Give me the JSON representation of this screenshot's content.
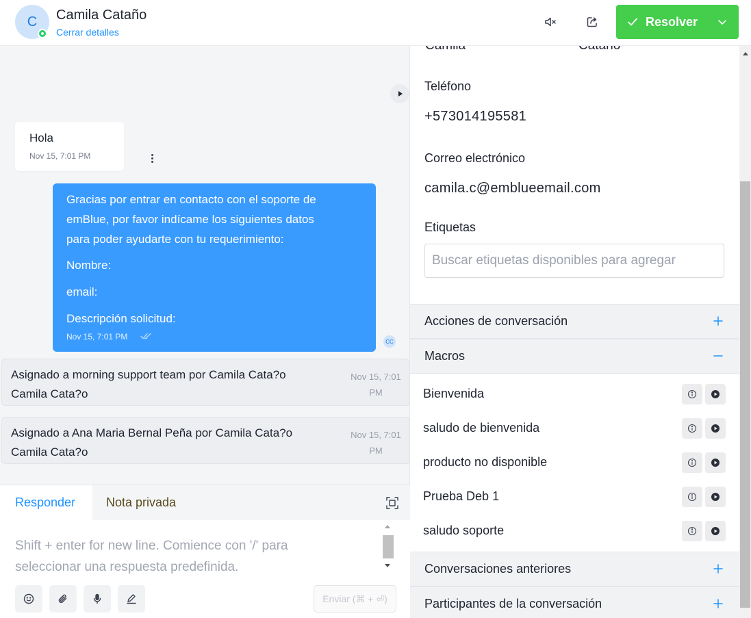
{
  "header": {
    "avatar_initial": "C",
    "contact_name": "Camila Cataño",
    "close_details": "Cerrar detalles",
    "mute_icon": "volume-mute-icon",
    "share_icon": "share-icon",
    "resolve_label": "Resolver",
    "accent": "#44ce4b",
    "channel_icon": "whatsapp-icon"
  },
  "chat": {
    "incoming": {
      "text": "Hola",
      "time": "Nov 15, 7:01 PM"
    },
    "outgoing": {
      "lines": [
        "Gracias por entrar en contacto con el soporte de",
        "emBlue, por favor indícame los siguientes datos",
        "para poder ayudarte con tu requerimiento:",
        "Nombre:",
        "email:",
        "Descripción solicitud:"
      ],
      "time": "Nov 15, 7:01 PM",
      "agent_initials": "CC",
      "bubble_color": "#3a9bff"
    },
    "activities": [
      {
        "line1": "Asignado a morning support team por Camila Cata?o",
        "line2": "Camila Cata?o",
        "time1": "Nov 15, 7:01",
        "time2": "PM"
      },
      {
        "line1": "Asignado a Ana Maria Bernal Peña por Camila Cata?o",
        "line2": "Camila Cata?o",
        "time1": "Nov 15, 7:01",
        "time2": "PM"
      }
    ]
  },
  "reply": {
    "tab_reply": "Responder",
    "tab_note": "Nota privada",
    "placeholder_line1": "Shift + enter for new line. Comience con '/' para",
    "placeholder_line2": "seleccionar una respuesta predefinida.",
    "send_label": "Enviar (⌘ + ⏎)",
    "tools": [
      "emoji-icon",
      "attachment-icon",
      "microphone-icon",
      "signature-icon"
    ]
  },
  "panel": {
    "first_name": "Camila",
    "last_name": "Cataño",
    "phone_label": "Teléfono",
    "phone_value": "+573014195581",
    "email_label": "Correo electrónico",
    "email_value": "camila.c@emblueemail.com",
    "tags_label": "Etiquetas",
    "tags_placeholder": "Buscar etiquetas disponibles para agregar",
    "sections": {
      "actions": "Acciones de conversación",
      "macros": "Macros",
      "previous": "Conversaciones anteriores",
      "participants": "Participantes de la conversación"
    },
    "macros": [
      "Bienvenida",
      "saludo de bienvenida",
      "producto no disponible",
      "Prueba Deb 1",
      "saludo soporte"
    ]
  }
}
